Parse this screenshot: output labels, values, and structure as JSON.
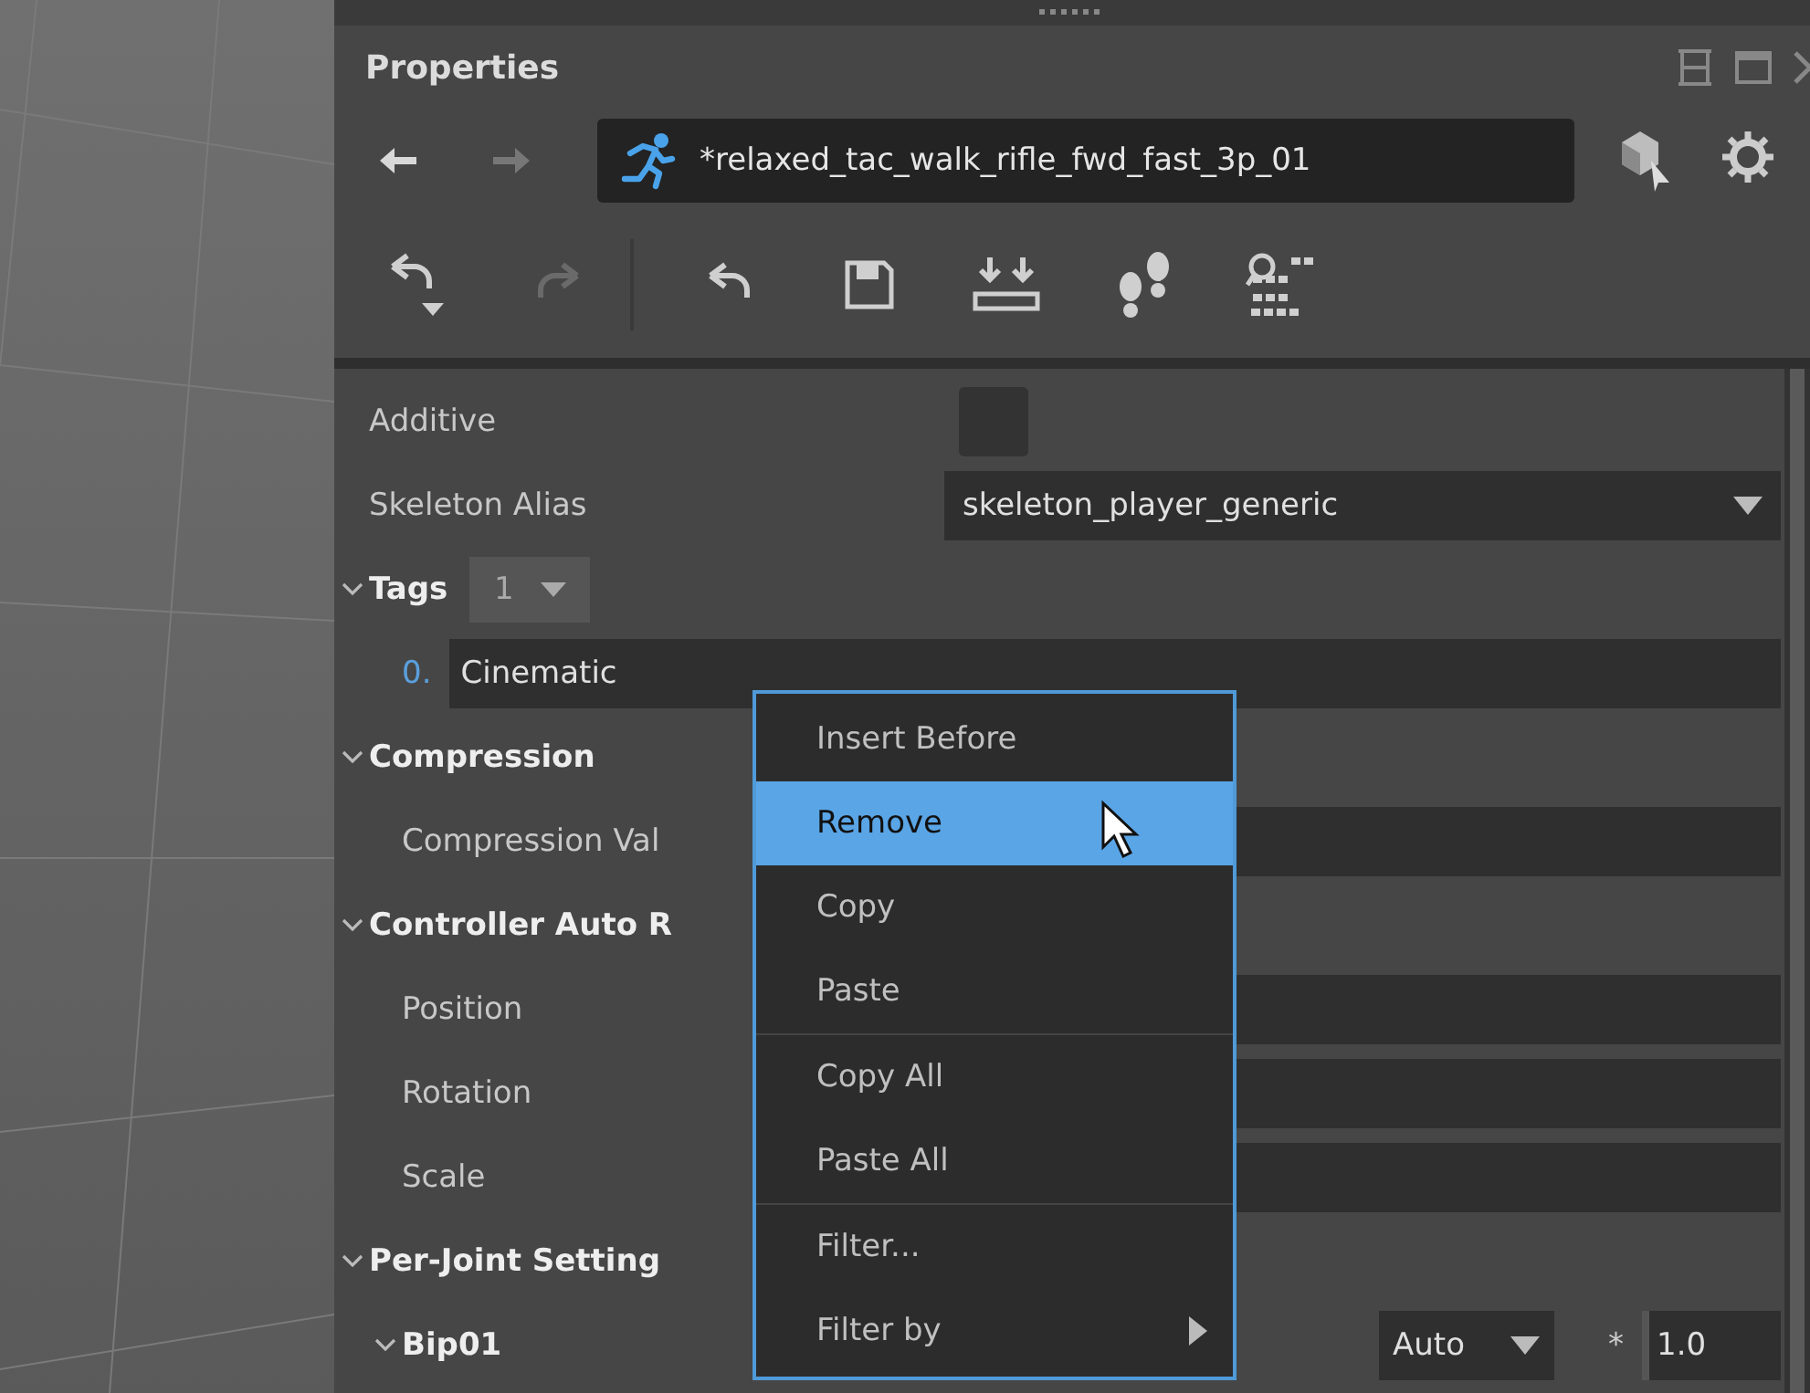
{
  "window": {
    "title": "Properties"
  },
  "navigation": {
    "back_disabled": false,
    "forward_disabled": true,
    "asset_name": "*relaxed_tac_walk_rifle_fwd_fast_3p_01"
  },
  "toolbar": [
    {
      "kind": "undo-menu",
      "disabled": false
    },
    {
      "kind": "redo",
      "disabled": true
    },
    {
      "kind": "undo",
      "disabled": false
    },
    {
      "kind": "save",
      "disabled": false
    },
    {
      "kind": "import",
      "disabled": false
    },
    {
      "kind": "footsteps",
      "disabled": false
    },
    {
      "kind": "search-grid",
      "disabled": false
    }
  ],
  "properties": [
    {
      "kind": "checkbox",
      "label": "Additive",
      "checked": false
    },
    {
      "kind": "dropdown",
      "label": "Skeleton Alias",
      "value": "skeleton_player_generic"
    },
    {
      "kind": "group",
      "label": "Tags",
      "expanded": true,
      "count": "1",
      "children": [
        {
          "kind": "list-item",
          "index": "0.",
          "value": "Cinematic"
        }
      ]
    },
    {
      "kind": "group",
      "label": "Compression",
      "expanded": true,
      "children": [
        {
          "kind": "field",
          "label": "Compression Val"
        }
      ]
    },
    {
      "kind": "group",
      "label": "Controller Auto R",
      "expanded": true,
      "children": [
        {
          "kind": "field",
          "label": "Position"
        },
        {
          "kind": "field",
          "label": "Rotation"
        },
        {
          "kind": "field",
          "label": "Scale"
        }
      ]
    },
    {
      "kind": "group",
      "label": "Per-Joint Setting",
      "expanded": true,
      "children": [
        {
          "kind": "joint",
          "label": "Bip01",
          "expanded": true,
          "mode": "Auto",
          "multiplier": "*",
          "value": "1.0"
        }
      ]
    }
  ],
  "context_menu": [
    {
      "label": "Insert Before",
      "selected": false,
      "separator_before": false,
      "submenu": false
    },
    {
      "label": "Remove",
      "selected": true,
      "separator_before": false,
      "submenu": false
    },
    {
      "label": "Copy",
      "selected": false,
      "separator_before": false,
      "submenu": false
    },
    {
      "label": "Paste",
      "selected": false,
      "separator_before": false,
      "submenu": false
    },
    {
      "label": "Copy All",
      "selected": false,
      "separator_before": true,
      "submenu": false
    },
    {
      "label": "Paste All",
      "selected": false,
      "separator_before": false,
      "submenu": false
    },
    {
      "label": "Filter...",
      "selected": false,
      "separator_before": true,
      "submenu": false
    },
    {
      "label": "Filter by",
      "selected": false,
      "separator_before": false,
      "submenu": true
    }
  ]
}
